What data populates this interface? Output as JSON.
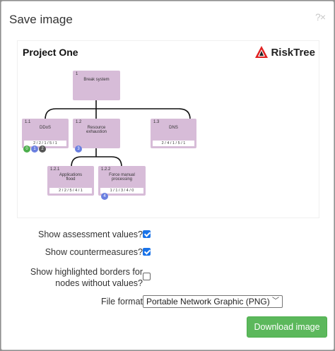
{
  "dialog": {
    "title": "Save image",
    "help_close": "?×"
  },
  "preview": {
    "project_title": "Project One",
    "logo_text": "RiskTree",
    "nodes": [
      {
        "id": "1",
        "label": "Break system",
        "values": ""
      },
      {
        "id": "1.1",
        "label": "DDoS",
        "values": "2 / 2 / 1 / 5 / 1"
      },
      {
        "id": "1.2",
        "label": "Resource exhaustion",
        "values": ""
      },
      {
        "id": "1.3",
        "label": "DNS",
        "values": "2 / 4 / 1 / 5 / 1"
      },
      {
        "id": "1.2.1",
        "label": "Applications flood",
        "values": "2 / 2 / 5 / 4 / 1"
      },
      {
        "id": "1.2.2",
        "label": "Force manual processing",
        "values": "1 / 1 / 3 / 4 / 0"
      }
    ],
    "badges": [
      {
        "text": "0",
        "color": "#4cae4c"
      },
      {
        "text": "1",
        "color": "#6a7fe0"
      },
      {
        "text": "2",
        "color": "#555555"
      },
      {
        "text": "3",
        "color": "#6a7fe0"
      },
      {
        "text": "4",
        "color": "#6a7fe0"
      }
    ]
  },
  "options": {
    "assessment_label": "Show assessment values?",
    "assessment_checked": true,
    "countermeasures_label": "Show countermeasures?",
    "countermeasures_checked": true,
    "borders_label_line1": "Show highlighted borders for",
    "borders_label_line2": "nodes without values?",
    "borders_checked": false,
    "format_label": "File format",
    "format_value": "Portable Network Graphic (PNG)"
  },
  "actions": {
    "download_label": "Download image"
  },
  "colors": {
    "node": "#d7bcd8",
    "checkbox": "#1a73e8",
    "button": "#5cb85c"
  }
}
